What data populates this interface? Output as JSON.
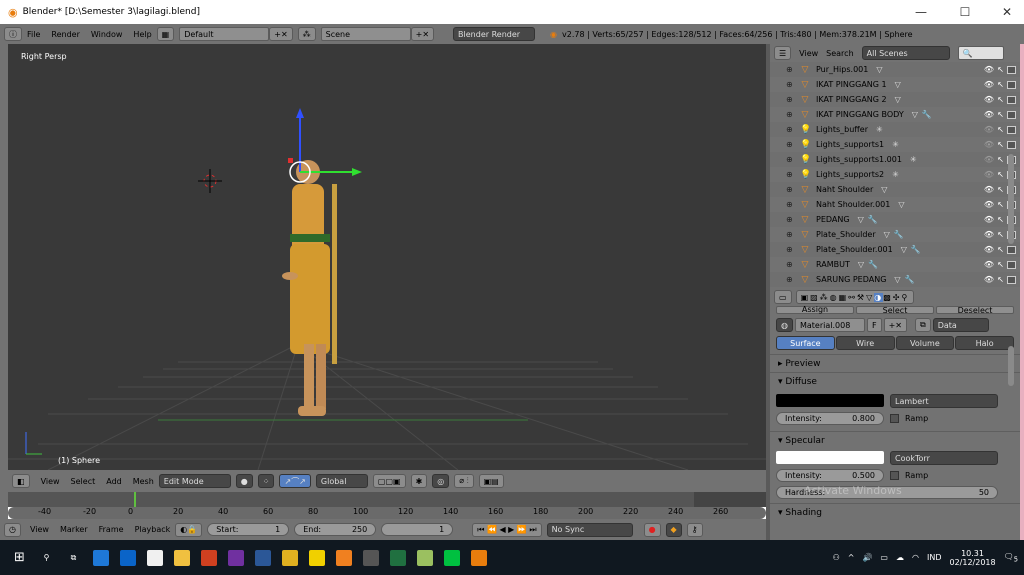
{
  "window": {
    "title": "Blender* [D:\\Semester 3\\lagilagi.blend]",
    "min": "—",
    "max": "☐",
    "close": "✕"
  },
  "info_header": {
    "menus": [
      "File",
      "Render",
      "Window",
      "Help"
    ],
    "screen": "Default",
    "scene": "Scene",
    "engine": "Blender Render",
    "stats": "v2.78 | Verts:65/257 | Edges:128/512 | Faces:64/256 | Tris:480 | Mem:378.21M | Sphere"
  },
  "viewport": {
    "view_label": "Right Persp",
    "object_label": "(1) Sphere"
  },
  "view3d_header": {
    "menus": [
      "View",
      "Select",
      "Add",
      "Mesh"
    ],
    "mode": "Edit Mode",
    "orientation": "Global"
  },
  "timeline": {
    "ticks": [
      "-40",
      "-20",
      "0",
      "20",
      "40",
      "60",
      "80",
      "100",
      "120",
      "140",
      "160",
      "180",
      "200",
      "220",
      "240",
      "260"
    ],
    "menus": [
      "View",
      "Marker",
      "Frame",
      "Playback"
    ],
    "start_label": "Start:",
    "start": "1",
    "end_label": "End:",
    "end": "250",
    "current": "1",
    "sync": "No Sync"
  },
  "outliner": {
    "menus": [
      "View",
      "Search"
    ],
    "filter": "All Scenes",
    "items": [
      {
        "name": "Pur_Hips.001",
        "type": "mesh"
      },
      {
        "name": "IKAT PINGGANG 1",
        "type": "mesh"
      },
      {
        "name": "IKAT PINGGANG 2",
        "type": "mesh"
      },
      {
        "name": "IKAT PINGGANG BODY",
        "type": "mesh",
        "modifier": true
      },
      {
        "name": "Lights_buffer",
        "type": "lamp"
      },
      {
        "name": "Lights_supports1",
        "type": "lamp"
      },
      {
        "name": "Lights_supports1.001",
        "type": "lamp"
      },
      {
        "name": "Lights_supports2",
        "type": "lamp"
      },
      {
        "name": "Naht Shoulder",
        "type": "mesh"
      },
      {
        "name": "Naht Shoulder.001",
        "type": "mesh"
      },
      {
        "name": "PEDANG",
        "type": "mesh",
        "modifier": true
      },
      {
        "name": "Plate_Shoulder",
        "type": "mesh",
        "modifier": true
      },
      {
        "name": "Plate_Shoulder.001",
        "type": "mesh",
        "modifier": true
      },
      {
        "name": "RAMBUT",
        "type": "mesh",
        "modifier": true
      },
      {
        "name": "SARUNG PEDANG",
        "type": "mesh",
        "modifier": true
      }
    ]
  },
  "properties": {
    "assign": "Assign",
    "select": "Select",
    "deselect": "Deselect",
    "material": "Material.008",
    "fake": "F",
    "link": "Data",
    "tabs": [
      "Surface",
      "Wire",
      "Volume",
      "Halo"
    ],
    "active_tab": "Surface",
    "preview": "Preview",
    "diffuse": "Diffuse",
    "diffuse_color": "#000000",
    "diffuse_shader": "Lambert",
    "diffuse_intensity_label": "Intensity:",
    "diffuse_intensity": "0.800",
    "ramp": "Ramp",
    "specular": "Specular",
    "specular_color": "#ffffff",
    "specular_shader": "CookTorr",
    "specular_intensity_label": "Intensity:",
    "specular_intensity": "0.500",
    "hardness_label": "Hardness:",
    "hardness": "50",
    "shading": "Shading",
    "watermark": "Activate Windows"
  },
  "taskbar": {
    "lang": "IND",
    "time": "10.31",
    "date": "02/12/2018",
    "notifications": "5"
  },
  "colors": {
    "accent": "#5680c2",
    "viewport_bg": "#393939",
    "ui_bg": "#727272",
    "frame_marker": "#60c040"
  }
}
